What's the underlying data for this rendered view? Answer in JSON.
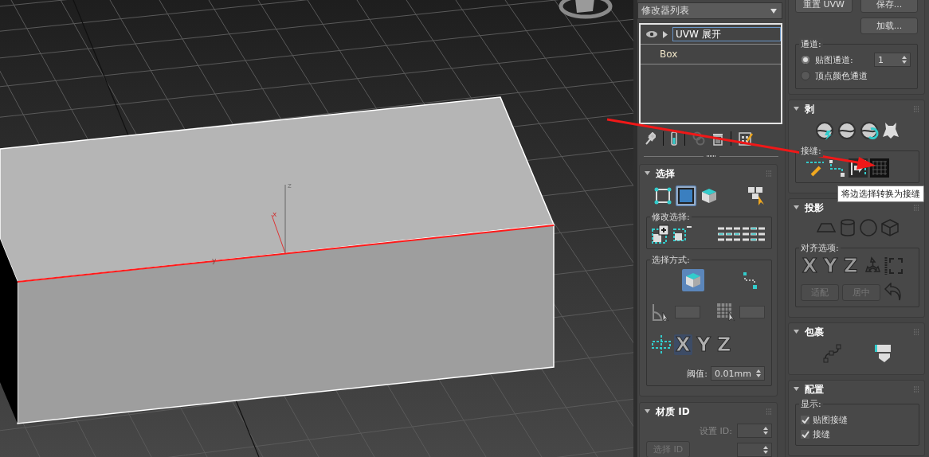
{
  "viewport": {
    "axis_labels": [
      "z",
      "x",
      "y"
    ]
  },
  "modifier_panel": {
    "dropdown": "修改器列表",
    "stack": [
      {
        "kind": "modifier",
        "name": "UVW 展开",
        "selected": true,
        "visible": true
      },
      {
        "kind": "base",
        "name": "Box",
        "selected": false
      }
    ]
  },
  "rollouts_left": [
    {
      "kind": "selection",
      "title": "选择",
      "expanded": true,
      "modes": [
        {
          "selected": false
        },
        {
          "selected": true
        },
        {
          "selected": false
        }
      ],
      "modify_group": "修改选择:",
      "method_group": "选择方式:",
      "by_element": {
        "selected": true
      },
      "axes": [
        {
          "label": "X",
          "selected": true
        },
        {
          "label": "Y",
          "selected": false
        },
        {
          "label": "Z",
          "selected": false
        }
      ],
      "threshold_label": "阈值:",
      "threshold_value": "0.01mm"
    },
    {
      "kind": "material_id",
      "title": "材质 ID",
      "expanded": true,
      "set_id_label": "设置 ID:",
      "select_id_button": "选择 ID"
    }
  ],
  "top_buttons": [
    {
      "label": "重置 UVW"
    },
    {
      "label": "保存..."
    },
    {
      "label": "加载..."
    }
  ],
  "channel_group": {
    "title": "通道:",
    "map_channel": "1",
    "options": [
      {
        "label": "贴图通道:",
        "selected": true
      },
      {
        "label": "顶点颜色通道",
        "selected": false
      }
    ]
  },
  "rollouts_right": [
    {
      "kind": "peel",
      "title": "剥",
      "expanded": true,
      "seams_group": "接缝:"
    },
    {
      "kind": "projection",
      "title": "投影",
      "expanded": true,
      "align_group": "对齐选项:",
      "axes": [
        {
          "label": "X"
        },
        {
          "label": "Y"
        },
        {
          "label": "Z"
        }
      ],
      "buttons": [
        {
          "label": "适配",
          "disabled": true
        },
        {
          "label": "居中",
          "disabled": true
        }
      ]
    },
    {
      "kind": "wrap",
      "title": "包裹",
      "expanded": true
    },
    {
      "kind": "configure",
      "title": "配置",
      "expanded": true,
      "display_group": "显示:",
      "checkboxes": [
        {
          "label": "贴图接缝",
          "checked": true
        },
        {
          "label": "接缝",
          "checked": true
        }
      ]
    }
  ],
  "tooltip": "将边选择转换为接缝"
}
